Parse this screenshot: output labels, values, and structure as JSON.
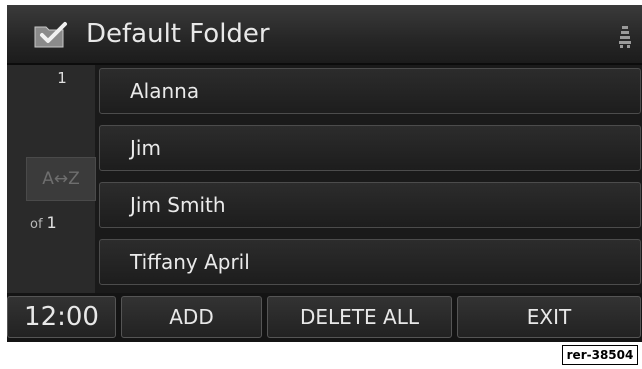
{
  "header": {
    "title": "Default Folder",
    "folder_icon": "folder-check-icon",
    "status_icon": "signal-icon"
  },
  "sidebar": {
    "page_current": "1",
    "sort_label": "A↔Z",
    "page_of_label": "of",
    "page_total": "1"
  },
  "entries": [
    {
      "label": "Alanna"
    },
    {
      "label": "Jim"
    },
    {
      "label": "Jim Smith"
    },
    {
      "label": "Tiffany April"
    }
  ],
  "bottom_bar": {
    "clock": "12:00",
    "add_label": "ADD",
    "delete_all_label": "DELETE ALL",
    "exit_label": "EXIT"
  },
  "figure_ref": "rer-38504"
}
